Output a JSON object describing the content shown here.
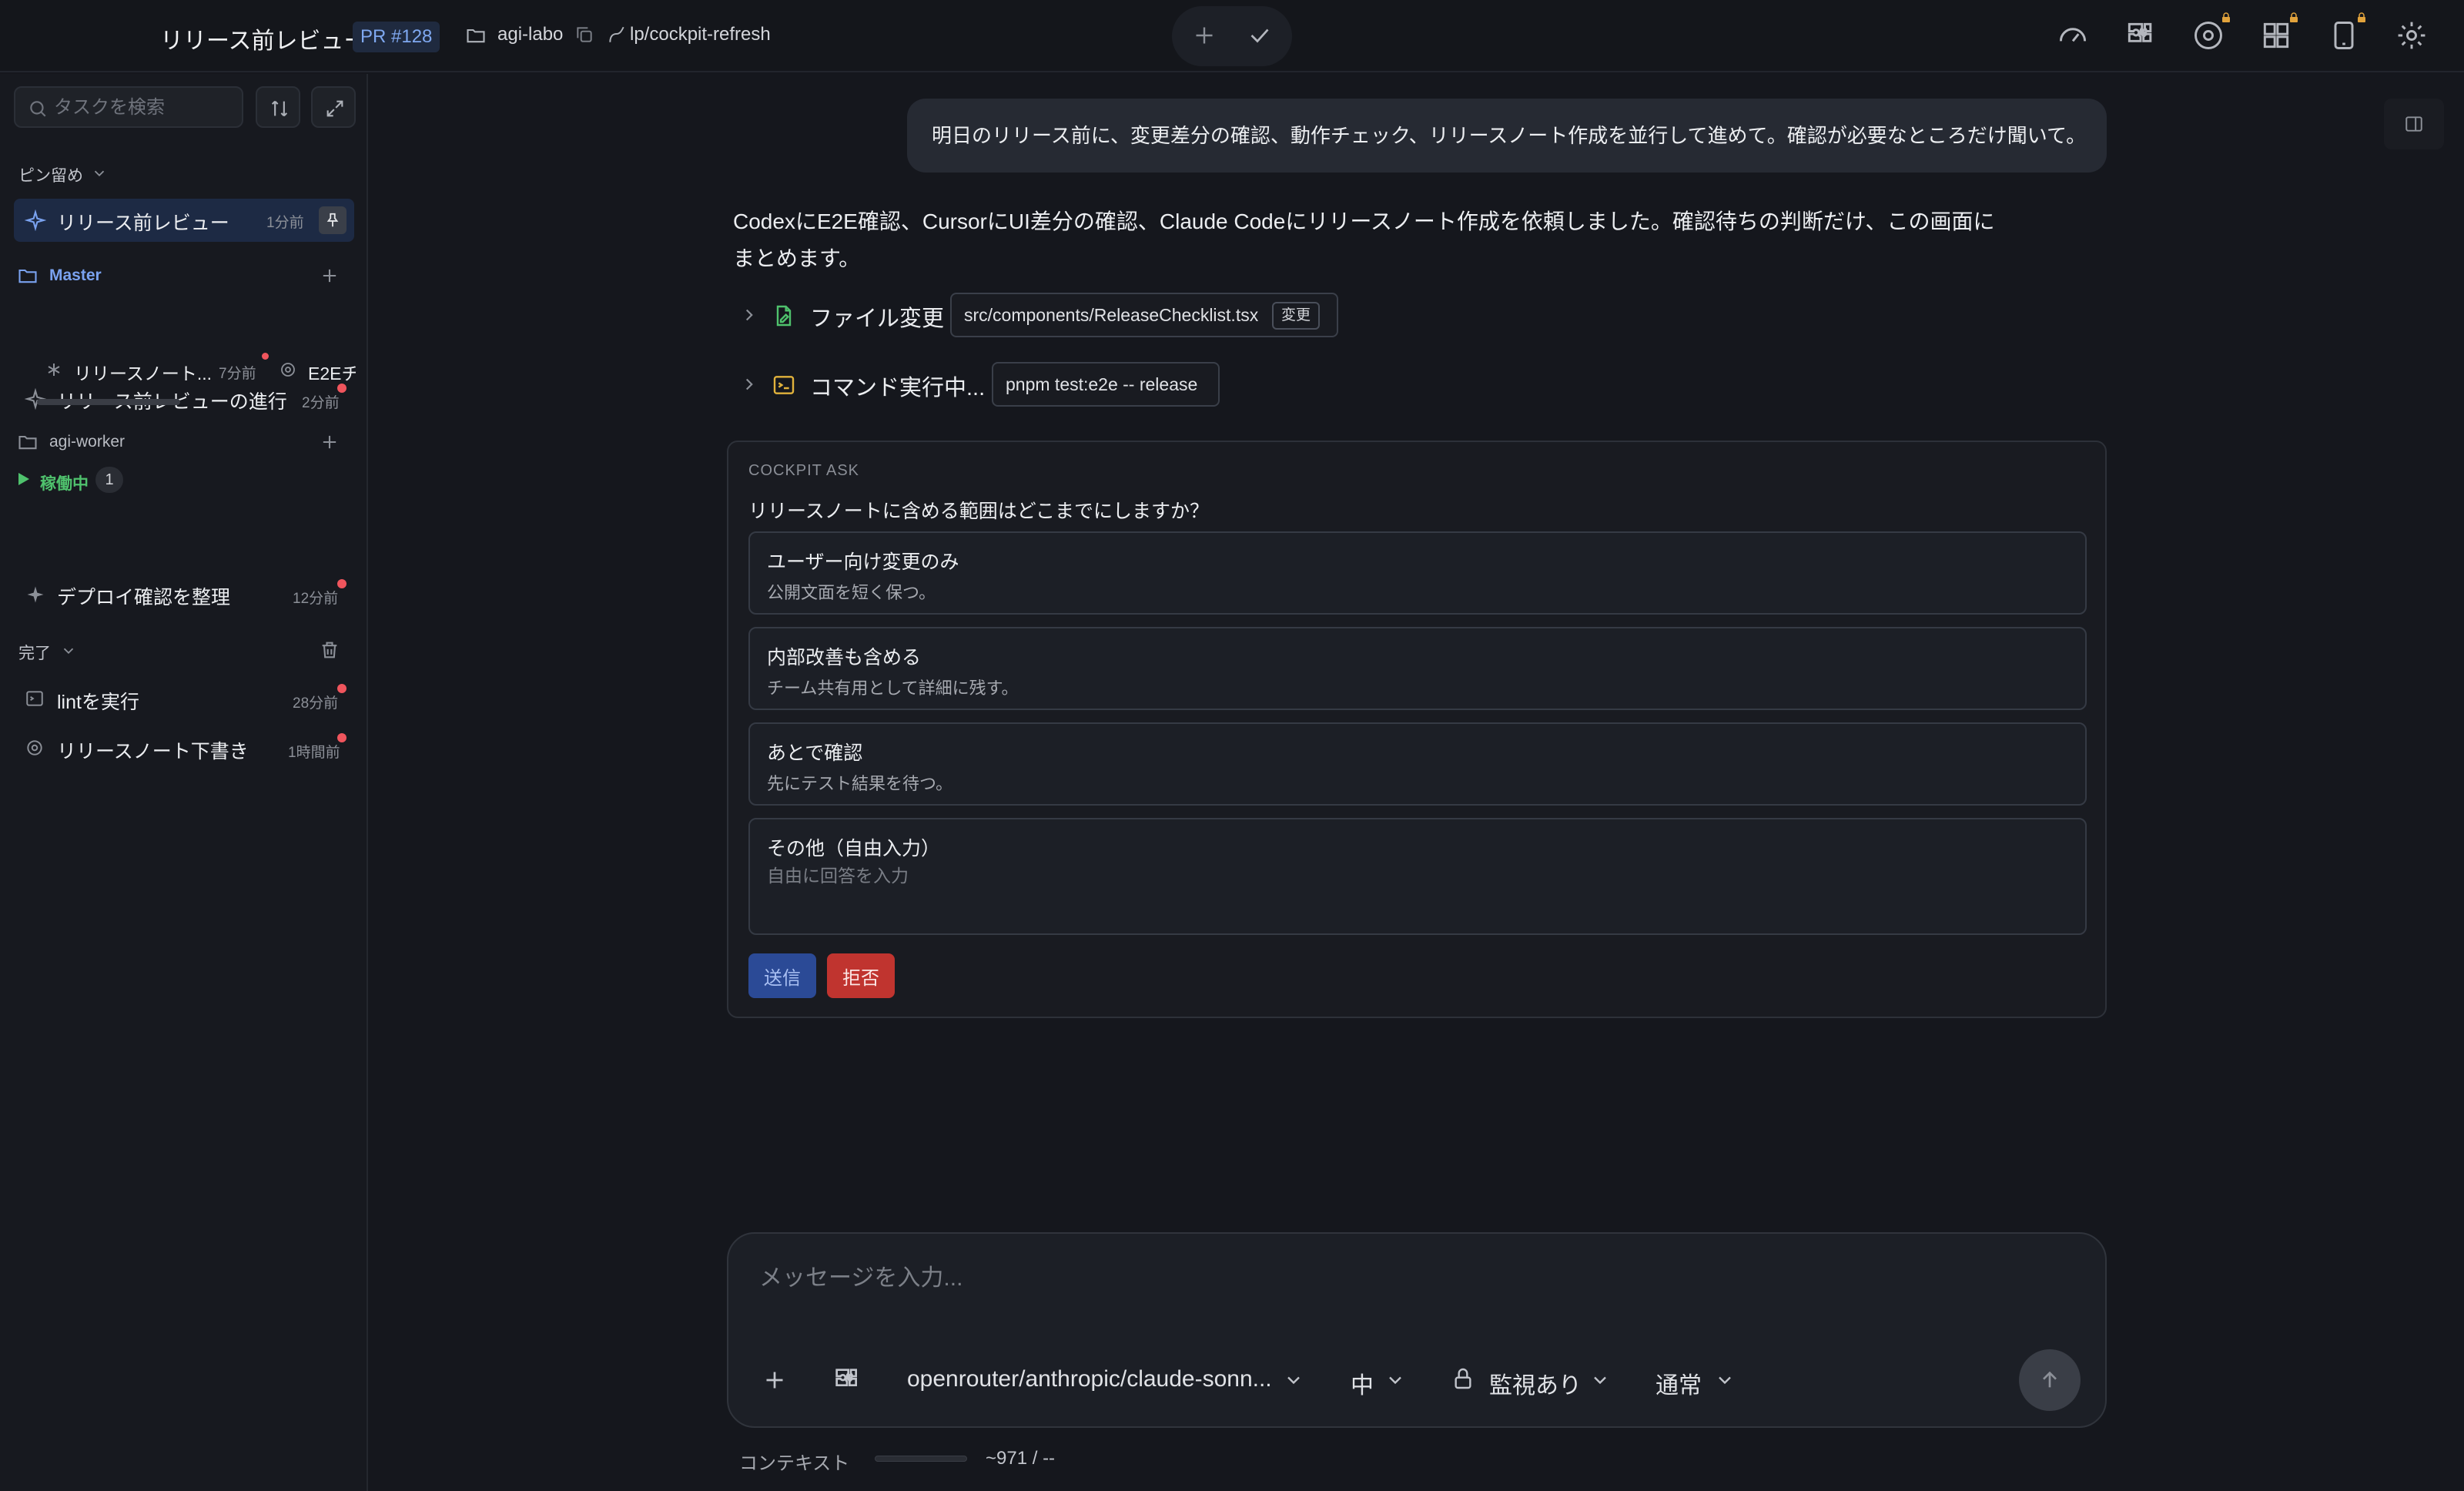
{
  "header": {
    "title": "リリース前レビュー",
    "pr_badge": "PR #128",
    "repo": "agi-labo",
    "branch": "lp/cockpit-refresh",
    "right_icons": [
      "speedometer-icon",
      "puzzle-icon",
      "disc-icon",
      "dashboard-icon",
      "phone-icon",
      "gear-icon"
    ]
  },
  "sidebar": {
    "search_placeholder": "タスクを検索",
    "pinned": {
      "label": "ピン留め",
      "item": {
        "label": "リリース前レビュー",
        "time": "1分前"
      }
    },
    "master": {
      "label": "Master",
      "item": {
        "label": "リリース前レビューの進行",
        "time": "2分前"
      },
      "sub_items": [
        {
          "label": "リリースノート...",
          "time": "7分前"
        },
        {
          "label": "E2Eチ"
        }
      ]
    },
    "worker": {
      "label": "agi-worker",
      "running_label": "稼働中",
      "running_count": "1",
      "item": {
        "label": "デプロイ確認を整理",
        "time": "12分前"
      }
    },
    "done": {
      "label": "完了",
      "items": [
        {
          "label": "lintを実行",
          "time": "28分前"
        },
        {
          "label": "リリースノート下書き",
          "time": "1時間前"
        }
      ]
    }
  },
  "chat": {
    "user_message": "明日のリリース前に、変更差分の確認、動作チェック、リリースノート作成を並行して進めて。確認が必要なところだけ聞いて。",
    "assistant_message": "CodexにE2E確認、CursorにUI差分の確認、Claude Codeにリリースノート作成を依頼しました。確認待ちの判断だけ、この画面にまとめます。",
    "tools": [
      {
        "label": "ファイル変更",
        "chip": "src/components/ReleaseChecklist.tsx",
        "badge": "変更"
      },
      {
        "label": "コマンド実行中...",
        "chip": "pnpm test:e2e -- release"
      }
    ]
  },
  "ask": {
    "header": "COCKPIT ASK",
    "question": "リリースノートに含める範囲はどこまでにしますか？",
    "options": [
      {
        "title": "ユーザー向け変更のみ",
        "desc": "公開文面を短く保つ。"
      },
      {
        "title": "内部改善も含める",
        "desc": "チーム共有用として詳細に残す。"
      },
      {
        "title": "あとで確認",
        "desc": "先にテスト結果を待つ。"
      }
    ],
    "other": {
      "title": "その他（自由入力）",
      "placeholder": "自由に回答を入力"
    },
    "send_label": "送信",
    "reject_label": "拒否"
  },
  "composer": {
    "placeholder": "メッセージを入力...",
    "model": "openrouter/anthropic/claude-sonn...",
    "effort": "中",
    "permission": "監視あり",
    "mode": "通常"
  },
  "footer": {
    "context_label": "コンテキスト",
    "context_value": "~971 / --"
  },
  "colors": {
    "accent": "#7aa2ef",
    "running": "#4fc26d",
    "notify_dot": "#f0555d",
    "reject": "#c0342f",
    "send": "#2b4a96"
  }
}
